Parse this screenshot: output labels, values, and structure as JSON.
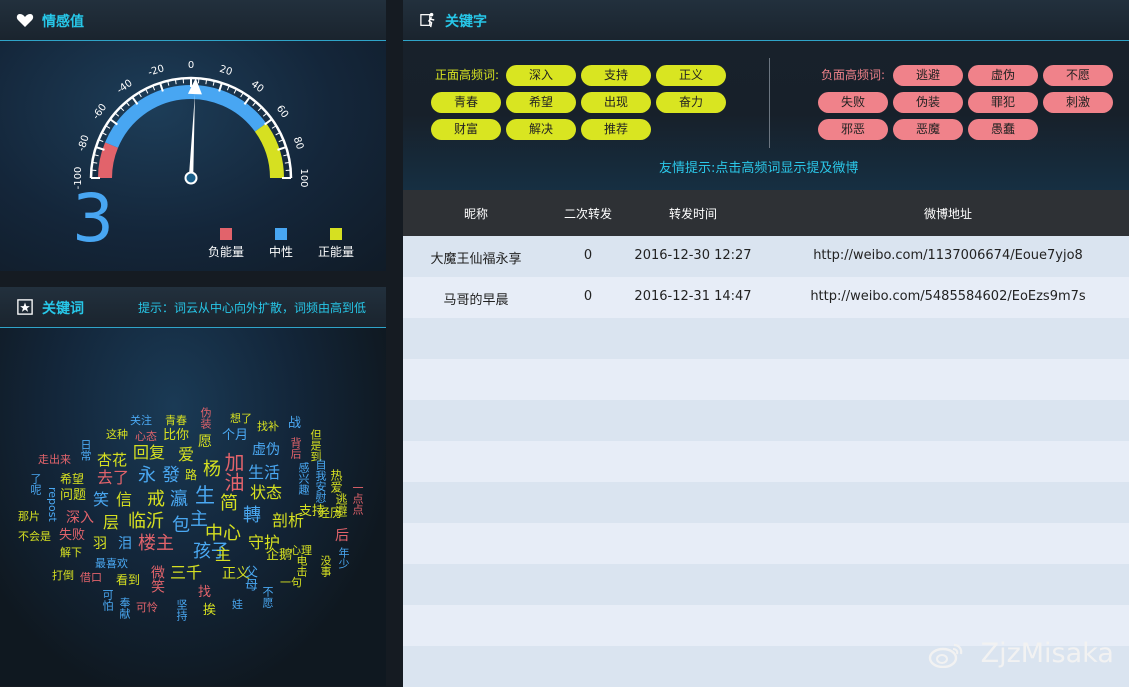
{
  "sentiment": {
    "title": "情感值",
    "value": "3",
    "gauge": {
      "min": -100,
      "max": 100,
      "value": 3,
      "ticks": [
        "-100",
        "-80",
        "-60",
        "-40",
        "-20",
        "0",
        "20",
        "40",
        "60",
        "80",
        "100"
      ]
    },
    "legend": [
      {
        "label": "负能量",
        "color": "#e2636b"
      },
      {
        "label": "中性",
        "color": "#48a6f2"
      },
      {
        "label": "正能量",
        "color": "#d6e021"
      }
    ]
  },
  "cloud": {
    "title": "关键词",
    "hint": "提示：词云从中心向外扩散，词频由高到低",
    "words": [
      {
        "t": "关注",
        "c": "#4aa8f2",
        "s": 11
      },
      {
        "t": "青春",
        "c": "#d6e021",
        "s": 11
      },
      {
        "t": "伪装",
        "c": "#e2636b",
        "s": 11,
        "v": 1
      },
      {
        "t": "想了",
        "c": "#d6e021",
        "s": 11
      },
      {
        "t": "这种",
        "c": "#d6e021",
        "s": 11
      },
      {
        "t": "心态",
        "c": "#e2636b",
        "s": 11
      },
      {
        "t": "比你",
        "c": "#d6e021",
        "s": 13
      },
      {
        "t": "愿",
        "c": "#d6e021",
        "s": 14
      },
      {
        "t": "个月",
        "c": "#4aa8f2",
        "s": 13
      },
      {
        "t": "找补",
        "c": "#d6e021",
        "s": 11
      },
      {
        "t": "战",
        "c": "#4aa8f2",
        "s": 13
      },
      {
        "t": "日常",
        "c": "#4aa8f2",
        "s": 11,
        "v": 1
      },
      {
        "t": "走出来",
        "c": "#e2636b",
        "s": 11
      },
      {
        "t": "杏花",
        "c": "#d6e021",
        "s": 15
      },
      {
        "t": "回复",
        "c": "#d6e021",
        "s": 16
      },
      {
        "t": "爱",
        "c": "#d6e021",
        "s": 16
      },
      {
        "t": "加油",
        "c": "#e2636b",
        "s": 20,
        "v": 1
      },
      {
        "t": "虚伪",
        "c": "#4aa8f2",
        "s": 14
      },
      {
        "t": "背后",
        "c": "#e2636b",
        "s": 11,
        "v": 1
      },
      {
        "t": "但是到",
        "c": "#d6e021",
        "s": 11,
        "v": 1
      },
      {
        "t": "了呢",
        "c": "#4aa8f2",
        "s": 11,
        "v": 1
      },
      {
        "t": "希望",
        "c": "#d6e021",
        "s": 12
      },
      {
        "t": "去了",
        "c": "#e2636b",
        "s": 16
      },
      {
        "t": "永",
        "c": "#4aa8f2",
        "s": 18
      },
      {
        "t": "發",
        "c": "#4aa8f2",
        "s": 18
      },
      {
        "t": "路",
        "c": "#d6e021",
        "s": 12
      },
      {
        "t": "杨",
        "c": "#d6e021",
        "s": 18
      },
      {
        "t": "生活",
        "c": "#4aa8f2",
        "s": 16
      },
      {
        "t": "热爱",
        "c": "#d6e021",
        "s": 12,
        "v": 1
      },
      {
        "t": "自我安慰",
        "c": "#4aa8f2",
        "s": 11,
        "v": 1
      },
      {
        "t": "感兴趣",
        "c": "#4aa8f2",
        "s": 11,
        "v": 1
      },
      {
        "t": "一点点",
        "c": "#e2636b",
        "s": 11,
        "v": 1
      },
      {
        "t": "repost",
        "c": "#4aa8f2",
        "s": 11,
        "v": 1
      },
      {
        "t": "问题",
        "c": "#d6e021",
        "s": 13
      },
      {
        "t": "笑",
        "c": "#4aa8f2",
        "s": 16
      },
      {
        "t": "信",
        "c": "#d6e021",
        "s": 16
      },
      {
        "t": "戒",
        "c": "#d6e021",
        "s": 18
      },
      {
        "t": "瀛",
        "c": "#4aa8f2",
        "s": 18
      },
      {
        "t": "生",
        "c": "#4aa8f2",
        "s": 20
      },
      {
        "t": "简",
        "c": "#d6e021",
        "s": 18
      },
      {
        "t": "状态",
        "c": "#d6e021",
        "s": 16
      },
      {
        "t": "逃避",
        "c": "#d6e021",
        "s": 12,
        "v": 1
      },
      {
        "t": "那片",
        "c": "#d6e021",
        "s": 11
      },
      {
        "t": "深入",
        "c": "#e2636b",
        "s": 14
      },
      {
        "t": "层",
        "c": "#d6e021",
        "s": 16
      },
      {
        "t": "临沂",
        "c": "#d6e021",
        "s": 18
      },
      {
        "t": "包",
        "c": "#4aa8f2",
        "s": 18
      },
      {
        "t": "主",
        "c": "#4aa8f2",
        "s": 18
      },
      {
        "t": "轉",
        "c": "#4aa8f2",
        "s": 18
      },
      {
        "t": "剖析",
        "c": "#d6e021",
        "s": 16
      },
      {
        "t": "支持",
        "c": "#d6e021",
        "s": 13
      },
      {
        "t": "经历",
        "c": "#d6e021",
        "s": 12
      },
      {
        "t": "后",
        "c": "#e2636b",
        "s": 14
      },
      {
        "t": "不会是",
        "c": "#d6e021",
        "s": 11
      },
      {
        "t": "失败",
        "c": "#e2636b",
        "s": 13
      },
      {
        "t": "羽",
        "c": "#d6e021",
        "s": 14
      },
      {
        "t": "泪",
        "c": "#4aa8f2",
        "s": 14
      },
      {
        "t": "楼主",
        "c": "#e2636b",
        "s": 18
      },
      {
        "t": "中心",
        "c": "#d6e021",
        "s": 18
      },
      {
        "t": "守护",
        "c": "#d6e021",
        "s": 16
      },
      {
        "t": "心理",
        "c": "#d6e021",
        "s": 11
      },
      {
        "t": "年少",
        "c": "#4aa8f2",
        "s": 11,
        "v": 1
      },
      {
        "t": "解下",
        "c": "#d6e021",
        "s": 11
      },
      {
        "t": "最喜欢",
        "c": "#4aa8f2",
        "s": 11
      },
      {
        "t": "孩子",
        "c": "#4aa8f2",
        "s": 18
      },
      {
        "t": "主",
        "c": "#d6e021",
        "s": 16
      },
      {
        "t": "企鹅",
        "c": "#d6e021",
        "s": 13
      },
      {
        "t": "电击",
        "c": "#d6e021",
        "s": 11,
        "v": 1
      },
      {
        "t": "没事",
        "c": "#d6e021",
        "s": 11,
        "v": 1
      },
      {
        "t": "打倒",
        "c": "#d6e021",
        "s": 11
      },
      {
        "t": "借口",
        "c": "#e2636b",
        "s": 11
      },
      {
        "t": "看到",
        "c": "#d6e021",
        "s": 12
      },
      {
        "t": "微笑",
        "c": "#e2636b",
        "s": 14,
        "v": 1
      },
      {
        "t": "三千",
        "c": "#d6e021",
        "s": 16
      },
      {
        "t": "正义",
        "c": "#d6e021",
        "s": 14
      },
      {
        "t": "父母",
        "c": "#4aa8f2",
        "s": 13,
        "v": 1
      },
      {
        "t": "一句",
        "c": "#d6e021",
        "s": 11
      },
      {
        "t": "可怕",
        "c": "#4aa8f2",
        "s": 11,
        "v": 1
      },
      {
        "t": "奉献",
        "c": "#4aa8f2",
        "s": 11,
        "v": 1
      },
      {
        "t": "可怜",
        "c": "#e2636b",
        "s": 11
      },
      {
        "t": "找",
        "c": "#e2636b",
        "s": 13
      },
      {
        "t": "坚持",
        "c": "#4aa8f2",
        "s": 11,
        "v": 1
      },
      {
        "t": "挨",
        "c": "#d6e021",
        "s": 13
      },
      {
        "t": "娃",
        "c": "#4aa8f2",
        "s": 11
      },
      {
        "t": "不愿",
        "c": "#4aa8f2",
        "s": 11,
        "v": 1
      }
    ]
  },
  "keywords": {
    "title": "关键字",
    "positive_label": "正面高频词:",
    "negative_label": "负面高频词:",
    "positive": [
      "深入",
      "支持",
      "正义",
      "青春",
      "希望",
      "出现",
      "奋力",
      "财富",
      "解决",
      "推荐"
    ],
    "negative": [
      "逃避",
      "虚伪",
      "不愿",
      "失败",
      "伪装",
      "罪犯",
      "刺激",
      "邪恶",
      "恶魔",
      "愚蠢"
    ],
    "tip": "友情提示:点击高频词显示提及微博",
    "colors": {
      "positive": "#d9e521",
      "negative": "#f0828a"
    }
  },
  "table": {
    "headers": [
      "昵称",
      "二次转发",
      "转发时间",
      "微博地址"
    ],
    "rows": [
      [
        "大魔王仙福永享",
        "0",
        "2016-12-30 12:27",
        "http://weibo.com/1137006674/Eoue7yjo8"
      ],
      [
        "马哥的早晨",
        "0",
        "2016-12-31 14:47",
        "http://weibo.com/5485584602/EoEzs9m7s"
      ]
    ]
  },
  "watermark": "ZjzMisaka"
}
